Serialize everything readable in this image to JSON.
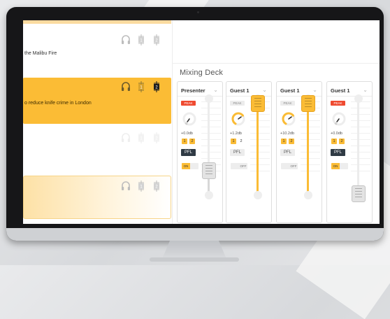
{
  "playlist": {
    "rows": [
      {
        "text": "the Malibu Fire",
        "cue1": "1",
        "cue2": "2"
      },
      {
        "text": "o reduce knife crime in London",
        "cue1": "1",
        "cue2": "2"
      },
      {
        "text": "",
        "cue1": "1",
        "cue2": "2"
      },
      {
        "text": "",
        "cue1": "1",
        "cue2": "2"
      }
    ]
  },
  "mixing_deck": {
    "title": "Mixing Deck",
    "channels": [
      {
        "name": "Presenter",
        "peak_label": "PEAK",
        "peak_active": true,
        "gain": "+0.0db",
        "bus1": "1",
        "bus2": "2",
        "bus1_on": true,
        "bus2_on": true,
        "pfl": "PFL",
        "pfl_active": true,
        "toggle": "ON",
        "toggle_on": true,
        "knob_level": 0.0,
        "fader_level": 0.24
      },
      {
        "name": "Guest 1",
        "peak_label": "PEAK",
        "peak_active": false,
        "gain": "+1.2db",
        "bus1": "1",
        "bus2": "2",
        "bus1_on": true,
        "bus2_on": false,
        "pfl": "PFL",
        "pfl_active": false,
        "toggle": "OFF",
        "toggle_on": false,
        "knob_level": 0.68,
        "fader_level": 0.95
      },
      {
        "name": "Guest 1",
        "peak_label": "PEAK",
        "peak_active": false,
        "gain": "+10.2db",
        "bus1": "1",
        "bus2": "2",
        "bus1_on": true,
        "bus2_on": true,
        "pfl": "PFL",
        "pfl_active": false,
        "toggle": "OFF",
        "toggle_on": false,
        "knob_level": 0.68,
        "fader_level": 0.95
      },
      {
        "name": "Guest 1",
        "peak_label": "PEAK",
        "peak_active": true,
        "gain": "+0.0db",
        "bus1": "1",
        "bus2": "2",
        "bus1_on": true,
        "bus2_on": true,
        "pfl": "PFL",
        "pfl_active": true,
        "toggle": "ON",
        "toggle_on": true,
        "knob_level": 0.0,
        "fader_level": 0.0
      }
    ]
  },
  "colors": {
    "accent": "#fbbc35",
    "peak": "#ef4a30",
    "pfl_dark": "#2f3a44"
  }
}
